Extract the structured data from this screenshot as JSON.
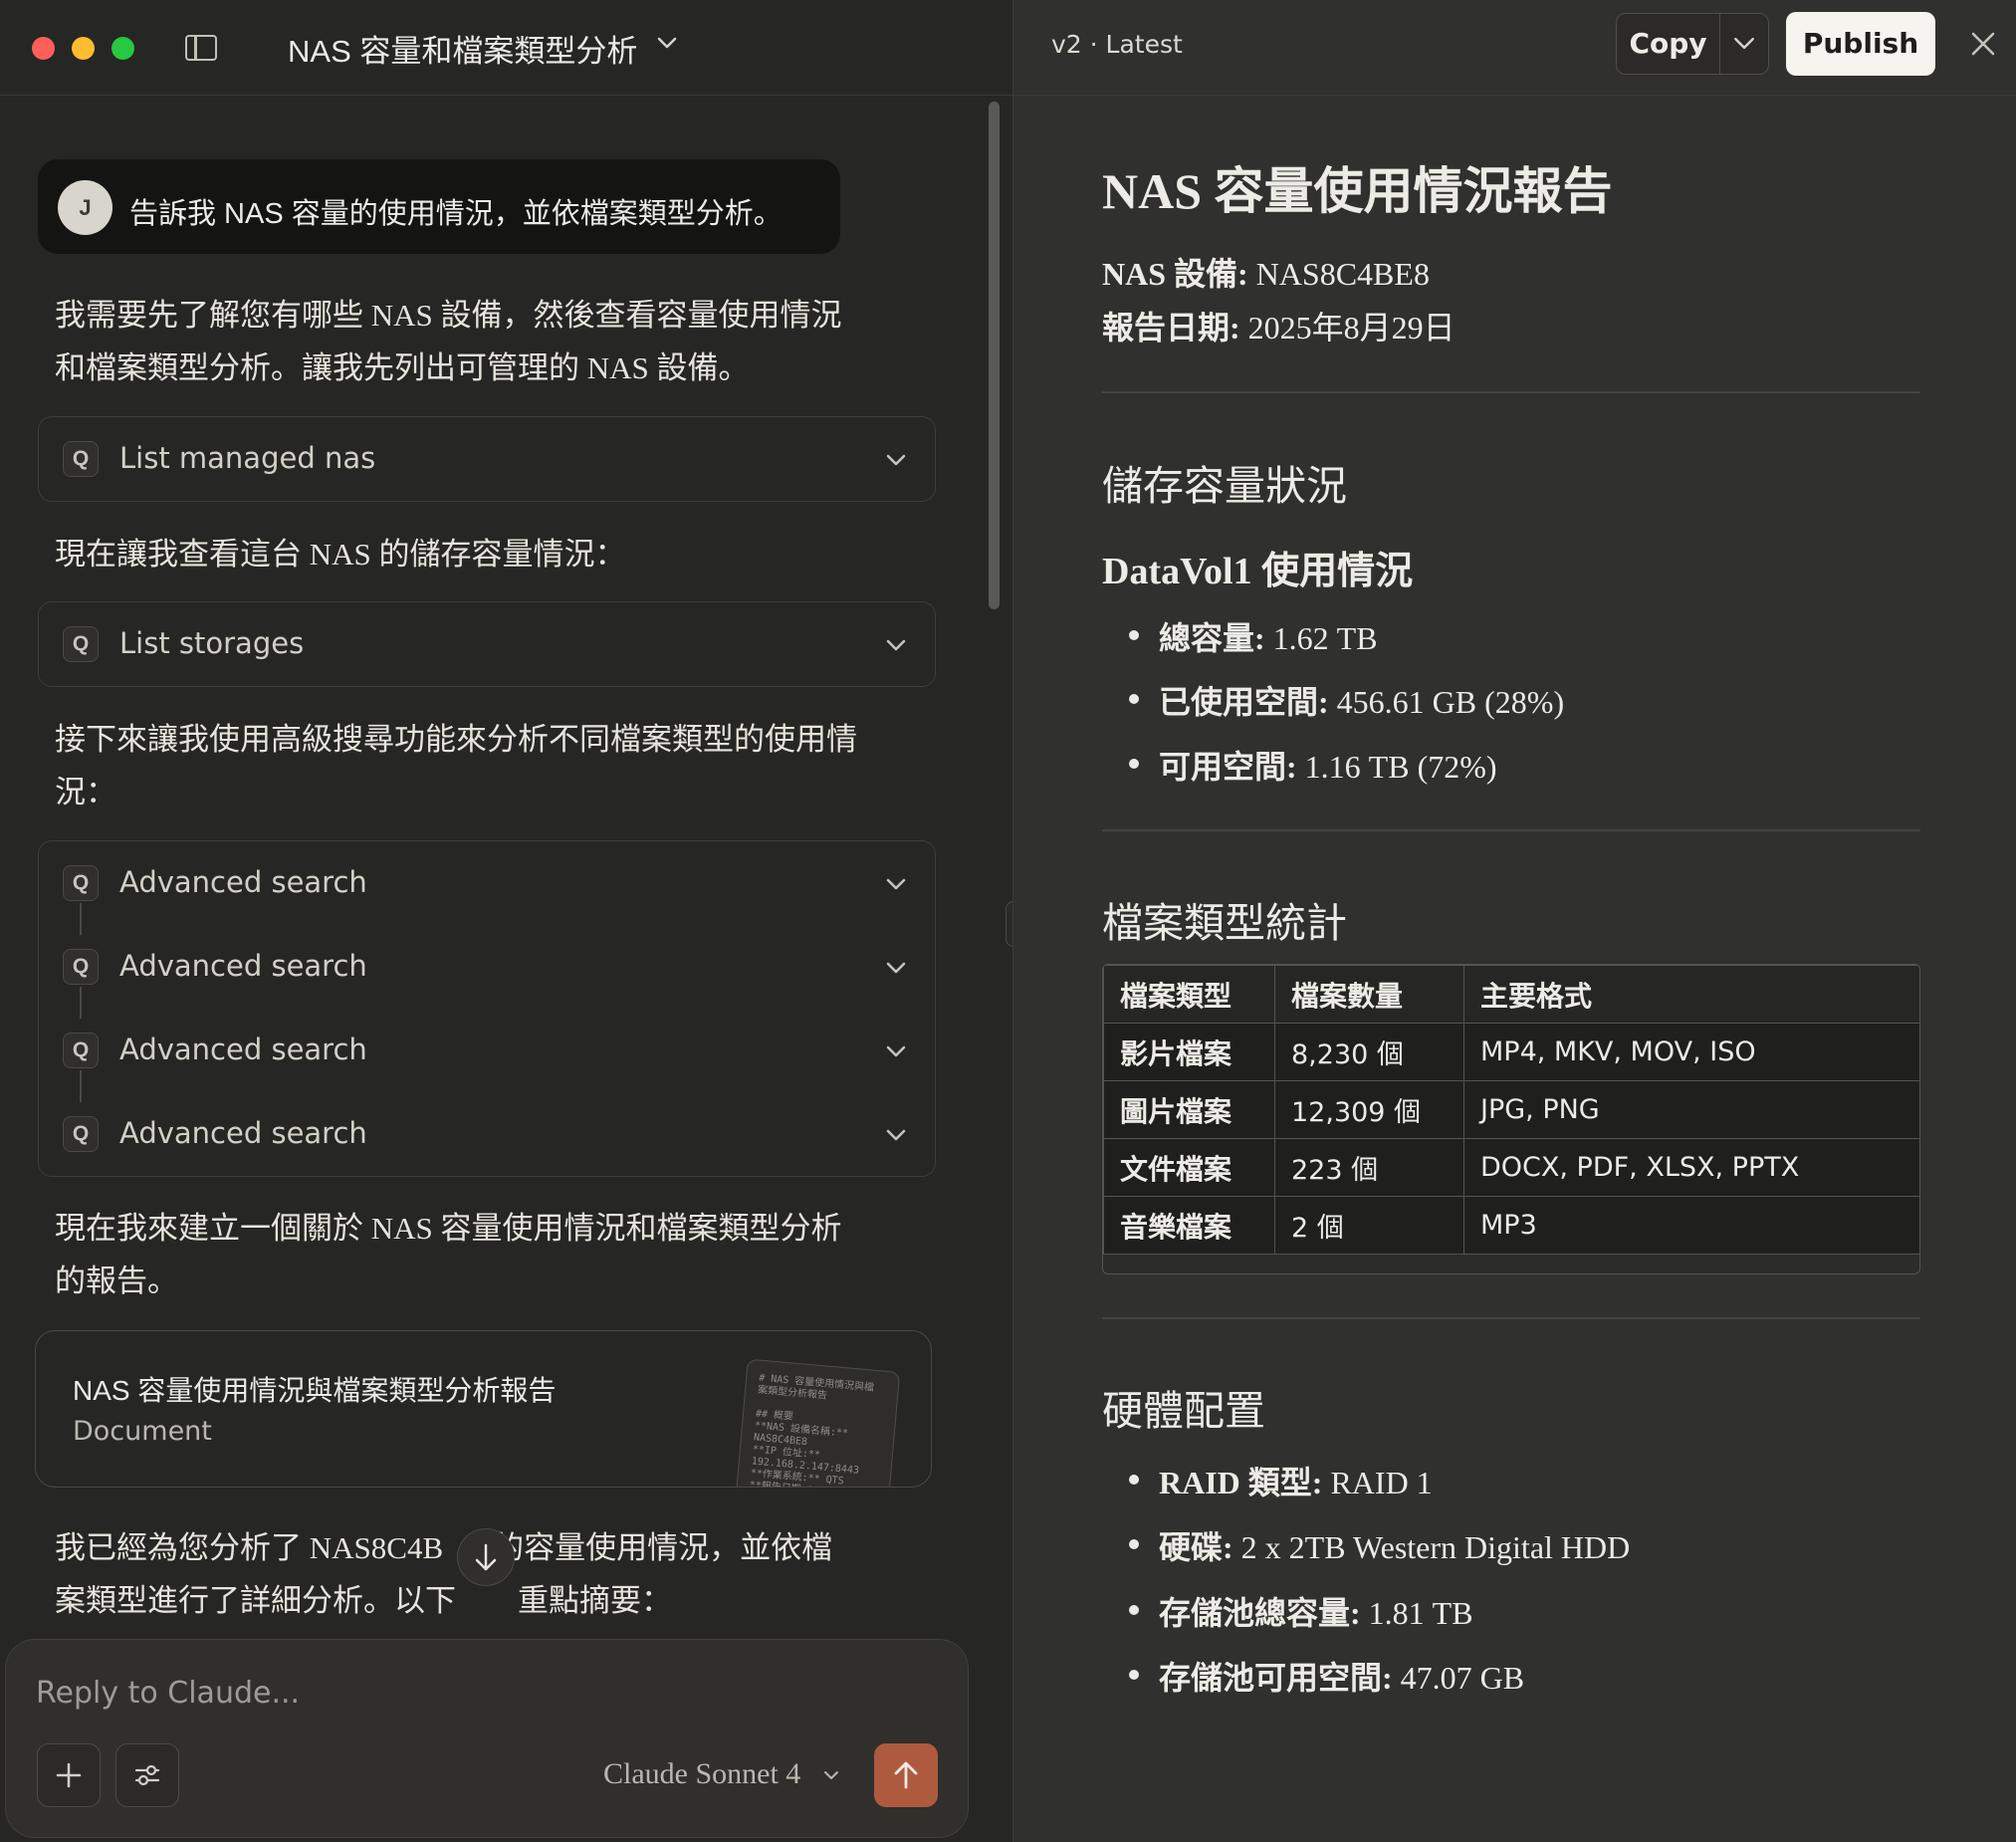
{
  "window": {
    "conversation_title": "NAS 容量和檔案類型分析"
  },
  "chat": {
    "user_initial": "J",
    "user_message": "告訴我 NAS 容量的使用情況，並依檔案類型分析。",
    "assistant_p1_line1": "我需要先了解您有哪些 NAS 設備，然後查看容量使用情況",
    "assistant_p1_line2": "和檔案類型分析。讓我先列出可管理的 NAS 設備。",
    "tool_list_nas": "List managed nas",
    "assistant_p2": "現在讓我查看這台 NAS 的儲存容量情況：",
    "tool_list_storages": "List storages",
    "assistant_p3_line1": "接下來讓我使用高級搜尋功能來分析不同檔案類型的使用情",
    "assistant_p3_line2": "況：",
    "tool_advanced_search": [
      "Advanced search",
      "Advanced search",
      "Advanced search",
      "Advanced search"
    ],
    "tool_badge": "Q",
    "assistant_p4_line1": "現在我來建立一個關於 NAS 容量使用情況和檔案類型分析",
    "assistant_p4_line2": "的報告。",
    "doc_card": {
      "title": "NAS 容量使用情況與檔案類型分析報告",
      "type": "Document",
      "thumb_text": "# NAS 容量使用情況與檔\n案類型分析報告\n\n## 概要\n**NAS 設備名稱:**\nNAS8C4BE8\n**IP 位址:**\n192.168.2.147:8443\n**作業系統:** QTS\n**報告日期:** 2025"
    },
    "assistant_p5_line1": "我已經為您分析了 NAS8C4B",
    "assistant_p5_line1b": "的容量使用情況，並依檔",
    "assistant_p5_line2a": "案類型進行了詳細分析。以下",
    "assistant_p5_line2b": "重點摘要："
  },
  "composer": {
    "placeholder": "Reply to Claude...",
    "model": "Claude Sonnet 4"
  },
  "artifact": {
    "version": "v2 · Latest",
    "copy_label": "Copy",
    "publish_label": "Publish"
  },
  "report": {
    "title": "NAS 容量使用情況報告",
    "device_label": "NAS 設備:",
    "device_value": " NAS8C4BE8",
    "date_label": "報告日期:",
    "date_value": " 2025年8月29日",
    "storage_heading": "儲存容量狀況",
    "volume_heading": "DataVol1 使用情況",
    "volume_items": [
      {
        "label": "總容量:",
        "value": " 1.62 TB"
      },
      {
        "label": "已使用空間:",
        "value": " 456.61 GB (28%)"
      },
      {
        "label": "可用空間:",
        "value": " 1.16 TB (72%)"
      }
    ],
    "filetype_heading": "檔案類型統計",
    "table_headers": [
      "檔案類型",
      "檔案數量",
      "主要格式"
    ],
    "table_rows": [
      [
        "影片檔案",
        "8,230 個",
        "MP4, MKV, MOV, ISO"
      ],
      [
        "圖片檔案",
        "12,309 個",
        "JPG, PNG"
      ],
      [
        "文件檔案",
        "223 個",
        "DOCX, PDF, XLSX, PPTX"
      ],
      [
        "音樂檔案",
        "2 個",
        "MP3"
      ]
    ],
    "hardware_heading": "硬體配置",
    "hardware_items": [
      {
        "label": "RAID 類型:",
        "value": " RAID 1"
      },
      {
        "label": "硬碟:",
        "value": " 2 x 2TB Western Digital HDD"
      },
      {
        "label": "存儲池總容量:",
        "value": " 1.81 TB"
      },
      {
        "label": "存儲池可用空間:",
        "value": " 47.07 GB"
      }
    ]
  }
}
